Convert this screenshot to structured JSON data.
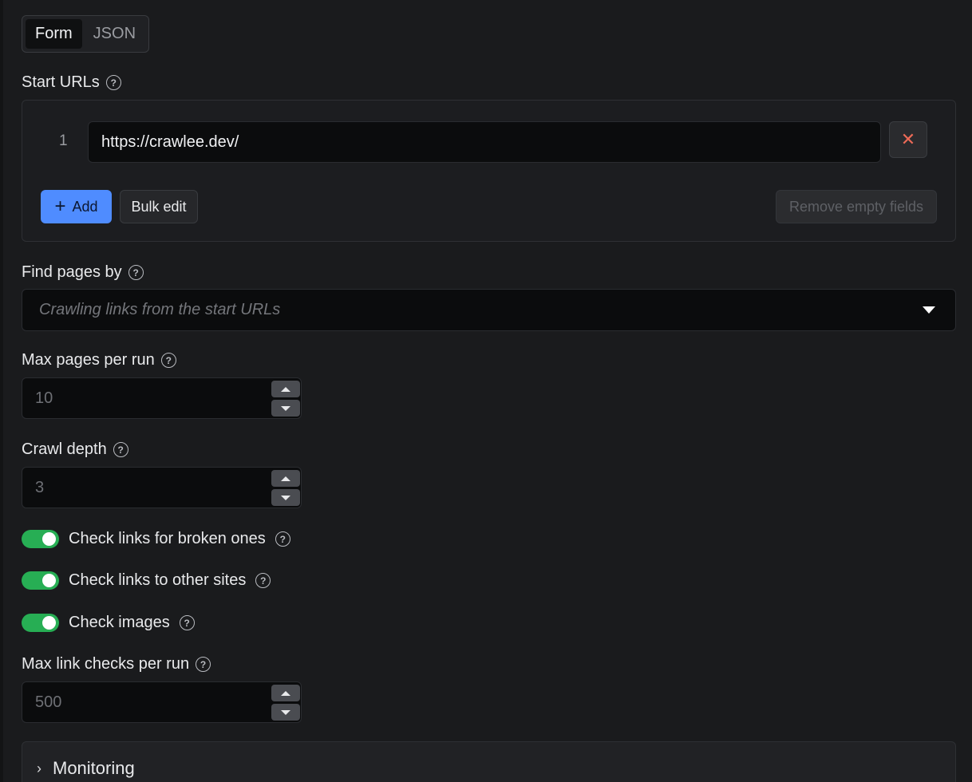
{
  "tabs": [
    {
      "label": "Form",
      "active": true
    },
    {
      "label": "JSON",
      "active": false
    }
  ],
  "start_urls": {
    "label": "Start URLs",
    "items": [
      {
        "index": "1",
        "value": "https://crawlee.dev/"
      }
    ],
    "remove_icon": "close-icon",
    "add_label": "Add",
    "bulk_edit_label": "Bulk edit",
    "remove_empty_label": "Remove empty fields"
  },
  "find_pages": {
    "label": "Find pages by",
    "placeholder": "Crawling links from the start URLs"
  },
  "max_pages": {
    "label": "Max pages per run",
    "placeholder": "10"
  },
  "crawl_depth": {
    "label": "Crawl depth",
    "placeholder": "3"
  },
  "toggles": [
    {
      "label": "Check links for broken ones",
      "on": true
    },
    {
      "label": "Check links to other sites",
      "on": true
    },
    {
      "label": "Check images",
      "on": true
    }
  ],
  "max_link_checks": {
    "label": "Max link checks per run",
    "placeholder": "500"
  },
  "monitoring": {
    "label": "Monitoring"
  },
  "colors": {
    "accent": "#4f8cff",
    "toggle_on": "#27ae54",
    "danger": "#ec6a57",
    "background": "#1a1b1d"
  }
}
